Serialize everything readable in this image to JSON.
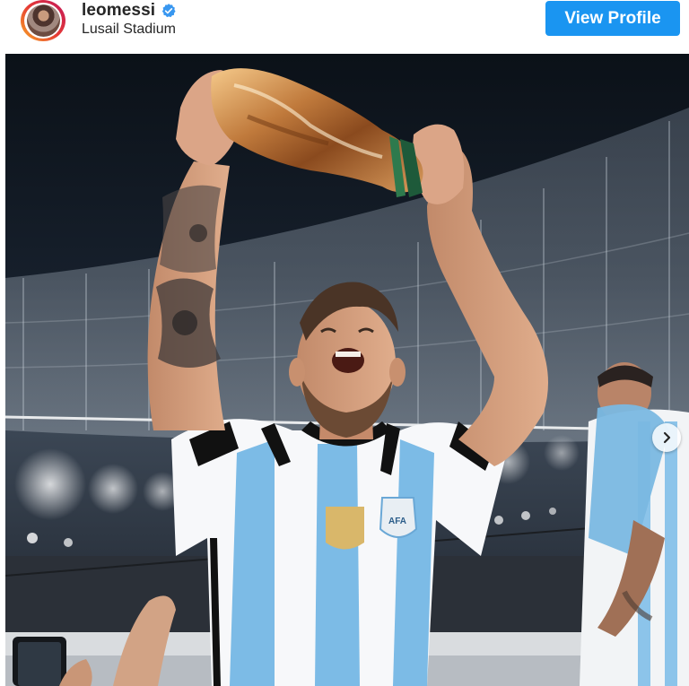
{
  "post": {
    "username": "leomessi",
    "verified": true,
    "location": "Lusail Stadium",
    "view_profile_label": "View Profile"
  },
  "photo": {
    "crest_text": "AFA"
  },
  "icons": {
    "verified": "verified-badge-icon",
    "next": "chevron-right-icon"
  },
  "colors": {
    "accent_blue": "#1a95f1",
    "verified_blue": "#3897f0",
    "text_primary": "#262626"
  }
}
